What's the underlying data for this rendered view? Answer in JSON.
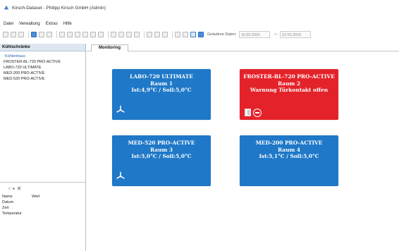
{
  "window": {
    "title": "Kirsch-Dataset - Philipp Kirsch GmbH (Admin)"
  },
  "menu": {
    "items": [
      "Datei",
      "Verwaltung",
      "Extras",
      "Hilfe"
    ]
  },
  "toolbar": {
    "range_label": "Geladene Daten:",
    "date_from": "19.03.2015",
    "date_to": "22.03.2015"
  },
  "sidebar": {
    "header": "Kühlschränke",
    "root": "Kühlenhaus",
    "items": [
      "FROSTER-BL-720 PRO-ACTIVE",
      "LABO-720 ULTIMATE",
      "MED-200 PRO-ACTIVE",
      "MED-520 PRO-ACTIVE"
    ]
  },
  "properties": {
    "tools": [
      "tool-icon",
      "tool-icon",
      "close-icon"
    ],
    "col_name": "Name",
    "col_value": "Wert",
    "rows": [
      "Datum",
      "Zeit",
      "Temperatur"
    ]
  },
  "tabs": [
    "Monitoring"
  ],
  "cards": [
    {
      "name": "LABO-720 ULTIMATE",
      "room": "Raum 1",
      "status": "Ist:4,9°C / Soll:5,0°C",
      "color": "#1f78c8",
      "icons": [
        "fan-icon"
      ]
    },
    {
      "name": "FROSTER-BL-720 PRO-ACTIVE",
      "room": "Raum 2",
      "status": "Warnung Türkontakt offen",
      "color": "#e4222a",
      "icons": [
        "door-icon",
        "stop-icon"
      ]
    },
    {
      "name": "MED-520 PRO-ACTIVE",
      "room": "Raum 3",
      "status": "Ist:5,0°C / Soll:5,0°C",
      "color": "#1f78c8",
      "icons": [
        "fan-icon"
      ]
    },
    {
      "name": "MED-200 PRO-ACTIVE",
      "room": "Raum 4",
      "status": "Ist:5,1°C / Soll:5,0°C",
      "color": "#1f78c8",
      "icons": []
    }
  ]
}
